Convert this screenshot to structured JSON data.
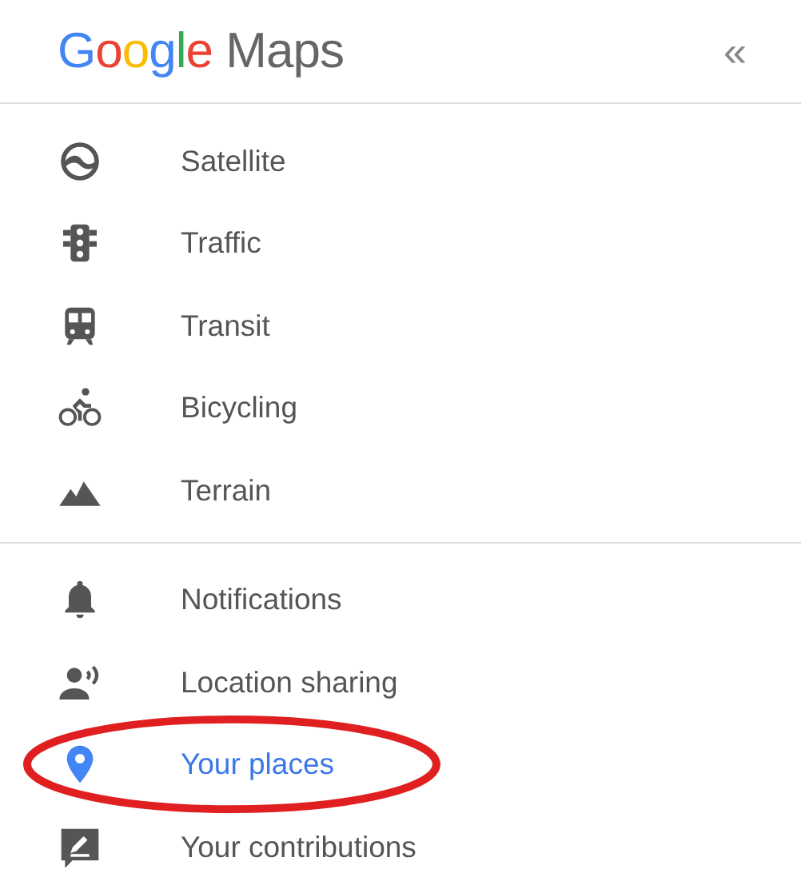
{
  "header": {
    "brand": "Google",
    "product": "Maps",
    "collapse": "«"
  },
  "sections": [
    {
      "items": [
        {
          "label": "Satellite",
          "selected": false,
          "circled": false
        },
        {
          "label": "Traffic",
          "selected": false,
          "circled": false
        },
        {
          "label": "Transit",
          "selected": false,
          "circled": false
        },
        {
          "label": "Bicycling",
          "selected": false,
          "circled": false
        },
        {
          "label": "Terrain",
          "selected": false,
          "circled": false
        }
      ]
    },
    {
      "items": [
        {
          "label": "Notifications",
          "selected": false,
          "circled": false
        },
        {
          "label": "Location sharing",
          "selected": false,
          "circled": false
        },
        {
          "label": "Your places",
          "selected": true,
          "circled": true
        },
        {
          "label": "Your contributions",
          "selected": false,
          "circled": false
        }
      ]
    }
  ]
}
